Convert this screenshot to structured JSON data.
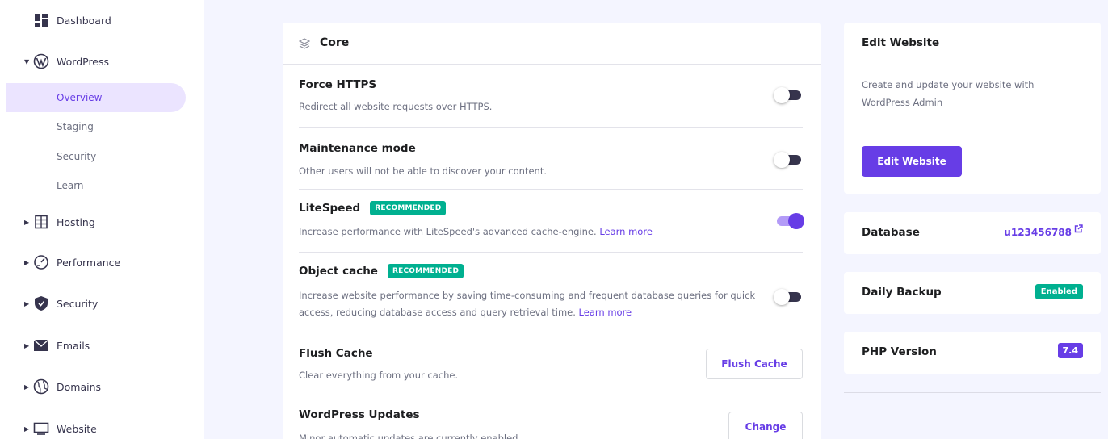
{
  "sidebar": {
    "items": [
      {
        "label": "Dashboard",
        "icon": "dashboard-icon"
      },
      {
        "label": "WordPress",
        "icon": "wordpress-icon"
      },
      {
        "label": "Hosting",
        "icon": "hosting-icon"
      },
      {
        "label": "Performance",
        "icon": "performance-icon"
      },
      {
        "label": "Security",
        "icon": "shield-icon"
      },
      {
        "label": "Emails",
        "icon": "envelope-icon"
      },
      {
        "label": "Domains",
        "icon": "globe-icon"
      },
      {
        "label": "Website",
        "icon": "monitor-icon"
      }
    ],
    "wordpress_sub": [
      {
        "label": "Overview",
        "active": true
      },
      {
        "label": "Staging"
      },
      {
        "label": "Security"
      },
      {
        "label": "Learn"
      }
    ]
  },
  "core": {
    "title": "Core",
    "rows": [
      {
        "title": "Force HTTPS",
        "desc": "Redirect all website requests over HTTPS.",
        "control": "toggle",
        "state": "off"
      },
      {
        "title": "Maintenance mode",
        "desc": "Other users will not be able to discover your content.",
        "control": "toggle",
        "state": "off"
      },
      {
        "title": "LiteSpeed",
        "badge": "RECOMMENDED",
        "desc": "Increase performance with LiteSpeed's advanced cache-engine.",
        "link": "Learn more",
        "control": "toggle",
        "state": "on"
      },
      {
        "title": "Object cache",
        "badge": "RECOMMENDED",
        "desc_line1": "Increase website performance by saving time-consuming and frequent database queries for quick",
        "desc_line2": "access, reducing database access and query retrieval time.",
        "link": "Learn more",
        "control": "toggle",
        "state": "off"
      },
      {
        "title": "Flush Cache",
        "desc": "Clear everything from your cache.",
        "control": "button",
        "button_label": "Flush Cache"
      },
      {
        "title": "WordPress Updates",
        "desc": "Minor automatic updates are currently enabled.",
        "control": "button",
        "button_label": "Change"
      }
    ]
  },
  "edit_website": {
    "title": "Edit Website",
    "desc": "Create and update your website with WordPress Admin",
    "button_label": "Edit Website"
  },
  "database": {
    "label": "Database",
    "value": "u123456788",
    "icon": "external-link-icon"
  },
  "daily_backup": {
    "label": "Daily Backup",
    "status": "Enabled"
  },
  "php_version": {
    "label": "PHP Version",
    "value": "7.4"
  },
  "colors": {
    "accent": "#673de6",
    "success": "#00b090",
    "active_bg": "#ebe4ff"
  }
}
